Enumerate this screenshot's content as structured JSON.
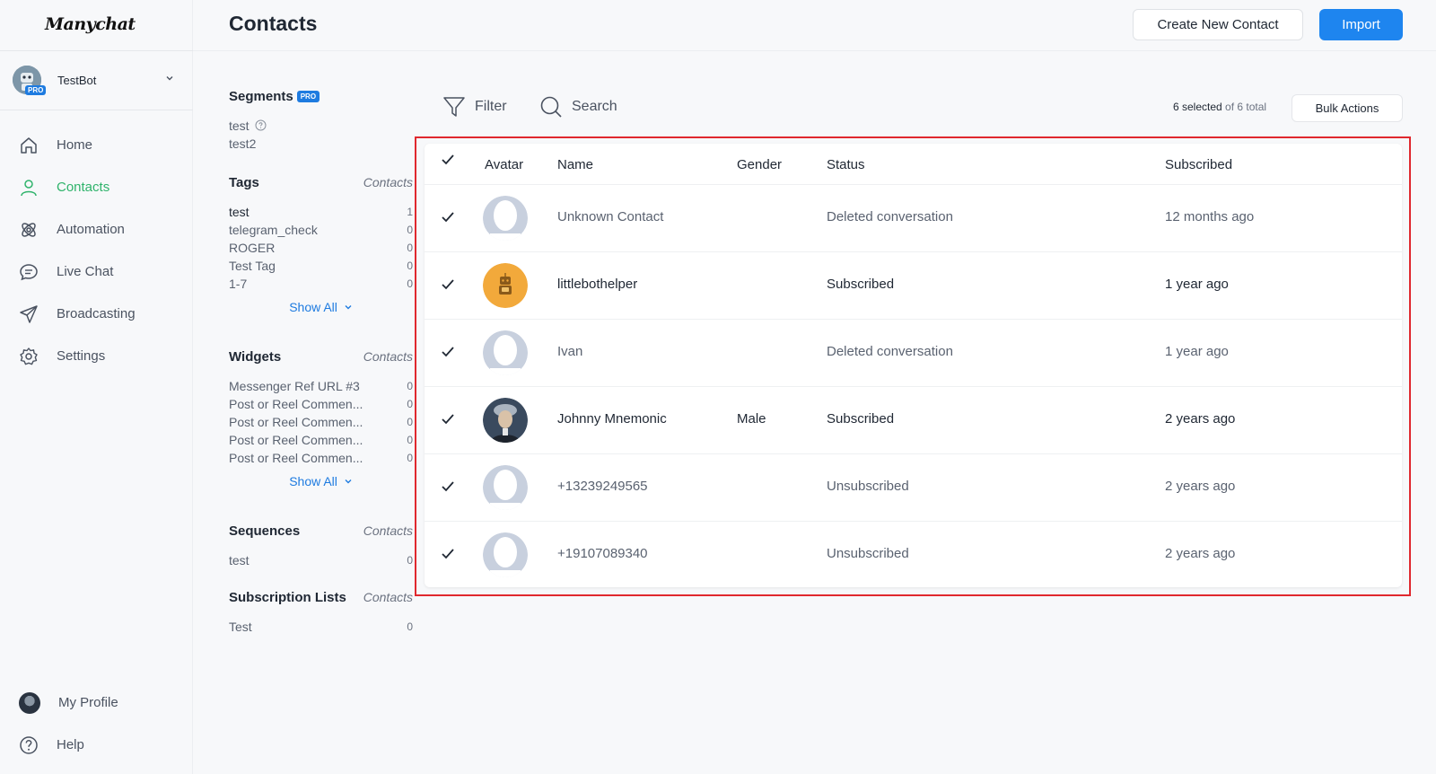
{
  "sidebar": {
    "logo": "Manychat",
    "bot_name": "TestBot",
    "bot_badge": "PRO",
    "nav": [
      {
        "label": "Home",
        "icon": "home-icon"
      },
      {
        "label": "Contacts",
        "icon": "contacts-icon",
        "active": true
      },
      {
        "label": "Automation",
        "icon": "automation-icon"
      },
      {
        "label": "Live Chat",
        "icon": "live-chat-icon"
      },
      {
        "label": "Broadcasting",
        "icon": "broadcasting-icon"
      },
      {
        "label": "Settings",
        "icon": "gear-icon"
      }
    ],
    "bottom": [
      {
        "label": "My Profile"
      },
      {
        "label": "Help"
      }
    ],
    "accent_color": "#2fb36b"
  },
  "header": {
    "title": "Contacts",
    "create_label": "Create New Contact",
    "import_label": "Import",
    "primary_color": "#1e85ef"
  },
  "filters": {
    "segments": {
      "title": "Segments",
      "badge": "PRO",
      "items": [
        "test",
        "test2"
      ]
    },
    "tags": {
      "title": "Tags",
      "contacts_label": "Contacts",
      "items": [
        {
          "name": "test",
          "count": "1"
        },
        {
          "name": "telegram_check",
          "count": "0"
        },
        {
          "name": "ROGER",
          "count": "0"
        },
        {
          "name": "Test Tag",
          "count": "0"
        },
        {
          "name": "1-7",
          "count": "0"
        }
      ],
      "show_all": "Show All"
    },
    "widgets": {
      "title": "Widgets",
      "contacts_label": "Contacts",
      "items": [
        {
          "name": "Messenger Ref URL #3",
          "count": "0"
        },
        {
          "name": "Post or Reel Commen...",
          "count": "0"
        },
        {
          "name": "Post or Reel Commen...",
          "count": "0"
        },
        {
          "name": "Post or Reel Commen...",
          "count": "0"
        },
        {
          "name": "Post or Reel Commen...",
          "count": "0"
        }
      ],
      "show_all": "Show All"
    },
    "sequences": {
      "title": "Sequences",
      "contacts_label": "Contacts",
      "items": [
        {
          "name": "test",
          "count": "0"
        }
      ]
    },
    "subscription_lists": {
      "title": "Subscription Lists",
      "contacts_label": "Contacts",
      "items": [
        {
          "name": "Test",
          "count": "0"
        }
      ]
    }
  },
  "toolbar": {
    "filter_label": "Filter",
    "search_label": "Search",
    "selected_text": "6 selected",
    "of_text": " of 6 total",
    "bulk_label": "Bulk Actions"
  },
  "table": {
    "columns": [
      "Avatar",
      "Name",
      "Gender",
      "Status",
      "Subscribed"
    ],
    "rows": [
      {
        "name": "Unknown Contact",
        "gender": "",
        "status": "Deleted conversation",
        "subscribed": "12 months ago",
        "avatar": "placeholder-avatar-icon",
        "active": false
      },
      {
        "name": "littlebothelper",
        "gender": "",
        "status": "Subscribed",
        "subscribed": "1 year ago",
        "avatar": "robot-avatar-icon",
        "active": true
      },
      {
        "name": "Ivan",
        "gender": "",
        "status": "Deleted conversation",
        "subscribed": "1 year ago",
        "avatar": "placeholder-avatar-icon",
        "active": false
      },
      {
        "name": "Johnny Mnemonic",
        "gender": "Male",
        "status": "Subscribed",
        "subscribed": "2 years ago",
        "avatar": "photo-avatar-icon",
        "active": true
      },
      {
        "name": "+13239249565",
        "gender": "",
        "status": "Unsubscribed",
        "subscribed": "2 years ago",
        "avatar": "placeholder-avatar-icon",
        "active": false
      },
      {
        "name": "+19107089340",
        "gender": "",
        "status": "Unsubscribed",
        "subscribed": "2 years ago",
        "avatar": "placeholder-avatar-icon",
        "active": false
      }
    ],
    "highlight_color": "#e0282e"
  }
}
